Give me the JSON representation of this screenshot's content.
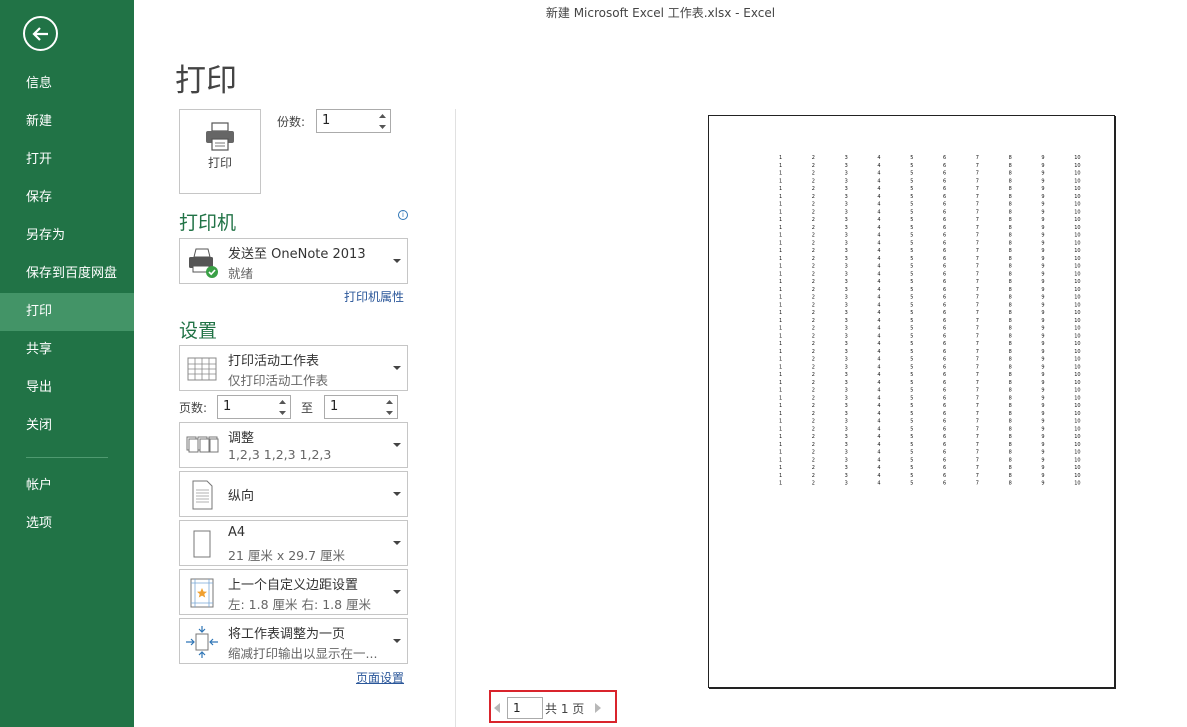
{
  "window": {
    "title": "新建 Microsoft Excel 工作表.xlsx - Excel"
  },
  "sidebar": {
    "back_icon": "back-arrow-icon",
    "items": [
      {
        "label": "信息"
      },
      {
        "label": "新建"
      },
      {
        "label": "打开"
      },
      {
        "label": "保存"
      },
      {
        "label": "另存为"
      },
      {
        "label": "保存到百度网盘"
      },
      {
        "label": "打印",
        "active": true
      },
      {
        "label": "共享"
      },
      {
        "label": "导出"
      },
      {
        "label": "关闭"
      },
      {
        "label": "帐户"
      },
      {
        "label": "选项"
      }
    ]
  },
  "main": {
    "title": "打印",
    "print_button": {
      "label": "打印",
      "icon": "printer-icon"
    },
    "copies": {
      "label": "份数:",
      "value": "1"
    },
    "printer": {
      "section_title": "打印机",
      "info_icon": "info-icon",
      "name": "发送至 OneNote 2013",
      "status": "就绪",
      "properties_link": "打印机属性"
    },
    "settings": {
      "section_title": "设置",
      "scope": {
        "line1": "打印活动工作表",
        "line2": "仅打印活动工作表"
      },
      "pages": {
        "label": "页数:",
        "from": "1",
        "to_label": "至",
        "to": "1"
      },
      "collate": {
        "line1": "调整",
        "line2": "1,2,3    1,2,3    1,2,3"
      },
      "orientation": {
        "line1": "纵向"
      },
      "paper": {
        "line1": "A4",
        "line2": "21 厘米 x 29.7 厘米"
      },
      "margins": {
        "line1": "上一个自定义边距设置",
        "line2": "左:  1.8 厘米    右:  1.8 厘米"
      },
      "scaling": {
        "line1": "将工作表调整为一页",
        "line2": "缩减打印输出以显示在一..."
      },
      "page_setup_link": "页面设置"
    }
  },
  "preview": {
    "columns": [
      "1",
      "2",
      "3",
      "4",
      "5",
      "6",
      "7",
      "8",
      "9",
      "10"
    ],
    "row_count": 43
  },
  "page_nav": {
    "current": "1",
    "total_label": "共 1 页"
  },
  "colors": {
    "sidebar": "#217346",
    "sidebar_active": "#439467",
    "accent": "#217346",
    "highlight_border": "#d9242c"
  }
}
